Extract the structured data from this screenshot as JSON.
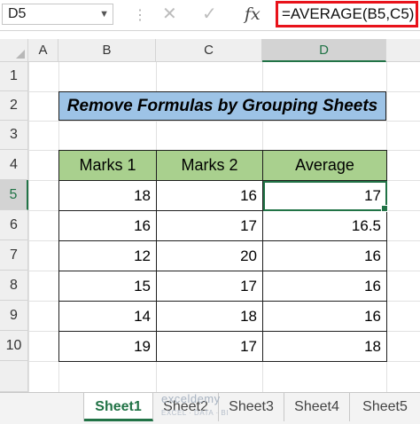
{
  "formula_bar": {
    "name_box": "D5",
    "cancel_icon": "✕",
    "enter_icon": "✓",
    "fx_label": "fx",
    "formula": "=AVERAGE(B5,C5)"
  },
  "columns": [
    "A",
    "B",
    "C",
    "D"
  ],
  "rows": [
    "1",
    "2",
    "3",
    "4",
    "5",
    "6",
    "7",
    "8",
    "9",
    "10"
  ],
  "title": "Remove Formulas by Grouping Sheets",
  "table": {
    "headers": [
      "Marks 1",
      "Marks 2",
      "Average"
    ],
    "rows": [
      [
        "18",
        "16",
        "17"
      ],
      [
        "16",
        "17",
        "16.5"
      ],
      [
        "12",
        "20",
        "16"
      ],
      [
        "15",
        "17",
        "16"
      ],
      [
        "14",
        "18",
        "16"
      ],
      [
        "19",
        "17",
        "18"
      ]
    ]
  },
  "sheet_tabs": [
    "Sheet1",
    "Sheet2",
    "Sheet3",
    "Sheet4",
    "Sheet5"
  ],
  "active_sheet": "Sheet1",
  "watermark": {
    "brand": "exceldemy",
    "tagline": "EXCEL · DATA · BI"
  },
  "colors": {
    "accent": "#217346",
    "title_fill": "#9dc3e6",
    "header_fill": "#a9d08e",
    "highlight": "#e8121a"
  }
}
